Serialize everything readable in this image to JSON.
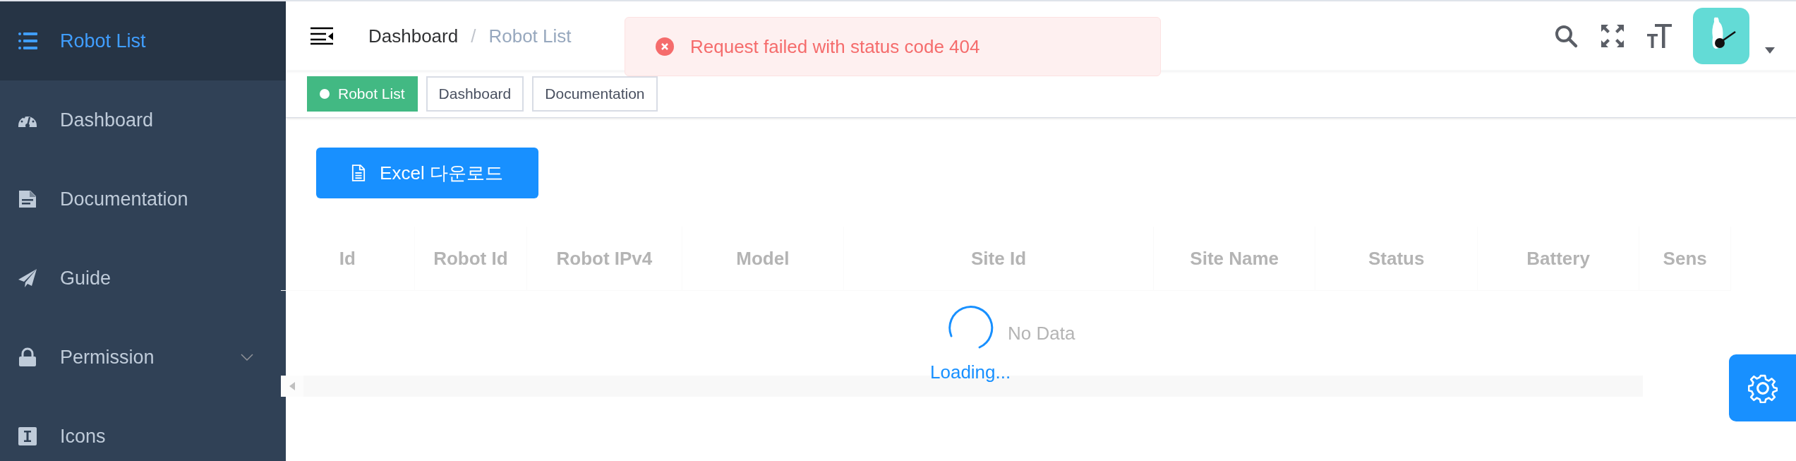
{
  "sidebar": {
    "items": [
      {
        "label": "Robot List",
        "kind": "link",
        "selected": true
      },
      {
        "label": "Dashboard",
        "kind": "link",
        "selected": false
      },
      {
        "label": "Documentation",
        "kind": "link",
        "selected": false
      },
      {
        "label": "Guide",
        "kind": "link",
        "selected": false
      },
      {
        "label": "Permission",
        "kind": "submenu",
        "expanded": false,
        "selected": false
      },
      {
        "label": "Icons",
        "kind": "link",
        "selected": false
      }
    ]
  },
  "breadcrumb": {
    "separator": "/",
    "items": [
      {
        "label": "Dashboard",
        "current": false
      },
      {
        "label": "Robot List",
        "current": true
      }
    ]
  },
  "tags": [
    {
      "label": "Robot List",
      "selected": true
    },
    {
      "label": "Dashboard",
      "selected": false
    },
    {
      "label": "Documentation",
      "selected": false
    }
  ],
  "toast": {
    "message": "Request failed with status code 404"
  },
  "excel_button": {
    "label": "Excel 다운로드"
  },
  "table": {
    "columns": [
      "Id",
      "Robot Id",
      "Robot IPv4",
      "Model",
      "Site Id",
      "Site Name",
      "Status",
      "Battery",
      "Sens"
    ],
    "empty_text": "No Data",
    "loading": true,
    "loading_text": "Loading..."
  }
}
